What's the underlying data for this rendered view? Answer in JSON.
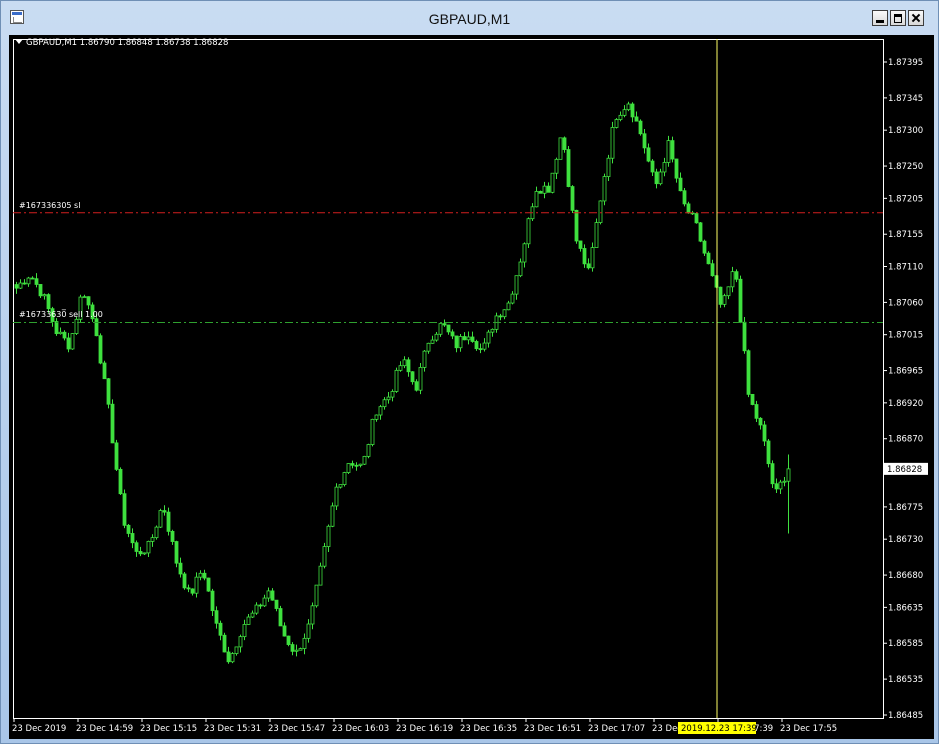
{
  "window": {
    "title": "GBPAUD,M1"
  },
  "header": {
    "symbol_info": "GBPAUD,M1  1.86790 1.86848 1.86738 1.86828"
  },
  "orders": {
    "sl_label": "#167336305 sl",
    "entry_label": "#16733630̅ sell 1.00",
    "sl_color": "#d11f1f",
    "entry_color": "#2fa02f"
  },
  "colors": {
    "background": "#000000",
    "candle": "#3fe03f",
    "axis": "#ffffff",
    "crosshair": "#ffff66",
    "price_box": "#ffffff",
    "time_box": "#ffff00"
  },
  "crosshair_time": "2019.12.23 17:39",
  "chart_data": {
    "type": "candlestick",
    "symbol": "GBPAUD",
    "timeframe": "M1",
    "ohlc_current": {
      "open": 1.8679,
      "high": 1.86848,
      "low": 1.86738,
      "close": 1.86828
    },
    "current_price_label": "1.86828",
    "stop_loss_price": 1.87185,
    "entry_price": 1.87032,
    "ylim": [
      1.86485,
      1.87395
    ],
    "y_ticks": [
      "1.87395",
      "1.87345",
      "1.87300",
      "1.87250",
      "1.87205",
      "1.87155",
      "1.87110",
      "1.87060",
      "1.87015",
      "1.86965",
      "1.86920",
      "1.86870",
      "1.86825",
      "1.86775",
      "1.86730",
      "1.86680",
      "1.86635",
      "1.86585",
      "1.86535",
      "1.86485"
    ],
    "x_ticks": [
      "23 Dec 2019",
      "23 Dec 14:59",
      "23 Dec 15:15",
      "23 Dec 15:31",
      "23 Dec 15:47",
      "23 Dec 16:03",
      "23 Dec 16:19",
      "23 Dec 16:35",
      "23 Dec 16:51",
      "23 Dec 17:07",
      "23 Dec 17:23",
      "23 Dec 17:39",
      "23 Dec 17:55"
    ],
    "close_path": [
      1.8708,
      1.871,
      1.8707,
      1.8702,
      1.87,
      1.8708,
      1.8702,
      1.869,
      1.8676,
      1.8671,
      1.8672,
      1.8678,
      1.867,
      1.8665,
      1.8669,
      1.8661,
      1.8656,
      1.8661,
      1.8663,
      1.8666,
      1.866,
      1.8657,
      1.8661,
      1.867,
      1.868,
      1.8684,
      1.8683,
      1.8691,
      1.8693,
      1.8698,
      1.8694,
      1.8701,
      1.8703,
      1.87,
      1.8702,
      1.8699,
      1.8704,
      1.8706,
      1.8713,
      1.8722,
      1.8722,
      1.873,
      1.8715,
      1.871,
      1.8722,
      1.8732,
      1.8734,
      1.8729,
      1.8722,
      1.8728,
      1.872,
      1.8717,
      1.8711,
      1.8705,
      1.8711,
      1.8693,
      1.8688,
      1.8679,
      1.8683
    ]
  }
}
